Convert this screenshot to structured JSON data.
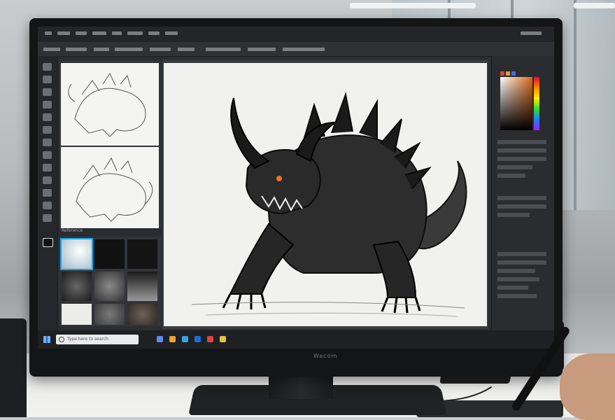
{
  "scene": {
    "description_type": "photo",
    "monitor": {
      "brand_label": "Wacom"
    },
    "software": {
      "taskbar": {
        "search_placeholder": "Type here to search"
      },
      "reference_panel": {
        "header_label": "Reference"
      }
    }
  },
  "colors": {
    "accent": "#1aa3e8",
    "canvas": "#f1f1ef",
    "ui_dark": "#2b2d30"
  },
  "icons": [
    "windows-icon",
    "search-icon",
    "brush-icon",
    "eraser-icon",
    "layers-icon"
  ]
}
